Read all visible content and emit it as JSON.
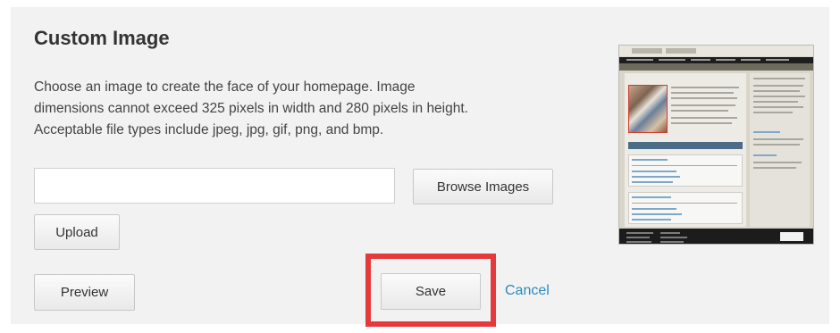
{
  "section": {
    "title": "Custom Image",
    "description_lines": [
      "Choose an image to create the face of your homepage. Image",
      "dimensions cannot exceed 325 pixels in width and 280 pixels in height.",
      "Acceptable file types include jpeg, jpg, gif, png, and bmp."
    ]
  },
  "file_input": {
    "value": ""
  },
  "buttons": {
    "browse": "Browse Images",
    "upload": "Upload",
    "preview": "Preview",
    "save": "Save",
    "cancel": "Cancel"
  },
  "colors": {
    "highlight": "#e53a3c",
    "link": "#2b8bbf",
    "panel_background": "#f2f2f2"
  },
  "thumbnail": {
    "icon": "homepage-preview-thumbnail"
  }
}
